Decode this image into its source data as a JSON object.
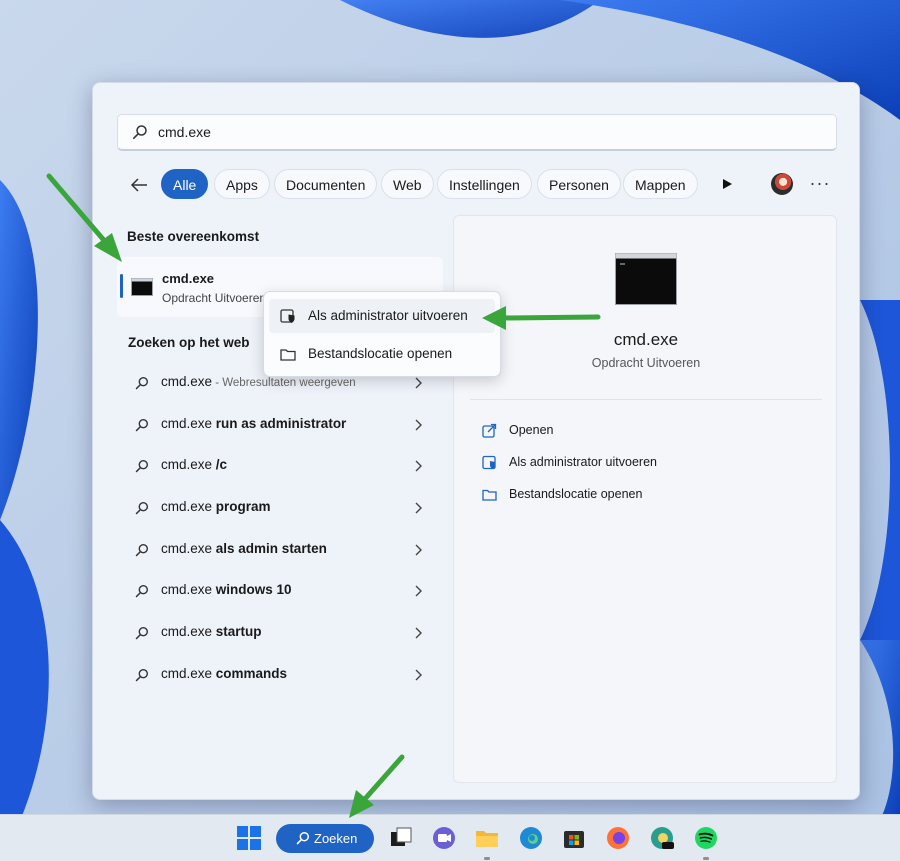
{
  "search": {
    "query": "cmd.exe"
  },
  "filters": [
    "Alle",
    "Apps",
    "Documenten",
    "Web",
    "Instellingen",
    "Personen",
    "Mappen"
  ],
  "best_match": {
    "heading": "Beste overeenkomst",
    "name": "cmd.exe",
    "type": "Opdracht Uitvoeren"
  },
  "web_section": {
    "heading": "Zoeken op het web",
    "items": [
      {
        "base": "cmd.exe",
        "bold": "",
        "sub": " - Webresultaten weergeven"
      },
      {
        "base": "cmd.exe",
        "bold": " run as administrator",
        "sub": ""
      },
      {
        "base": "cmd.exe",
        "bold": " /c",
        "sub": ""
      },
      {
        "base": "cmd.exe",
        "bold": " program",
        "sub": ""
      },
      {
        "base": "cmd.exe",
        "bold": " als admin starten",
        "sub": ""
      },
      {
        "base": "cmd.exe",
        "bold": " windows 10",
        "sub": ""
      },
      {
        "base": "cmd.exe",
        "bold": " startup",
        "sub": ""
      },
      {
        "base": "cmd.exe",
        "bold": " commands",
        "sub": ""
      }
    ]
  },
  "context_menu": {
    "run_as_admin": "Als administrator uitvoeren",
    "open_location": "Bestandslocatie openen"
  },
  "details": {
    "name": "cmd.exe",
    "type": "Opdracht Uitvoeren",
    "actions": {
      "open": "Openen",
      "run_as_admin": "Als administrator uitvoeren",
      "open_location": "Bestandslocatie openen"
    }
  },
  "taskbar": {
    "search_label": "Zoeken"
  },
  "colors": {
    "accent": "#1f63c4",
    "arrow": "#3aa53a",
    "panel": "#eef2f9"
  }
}
